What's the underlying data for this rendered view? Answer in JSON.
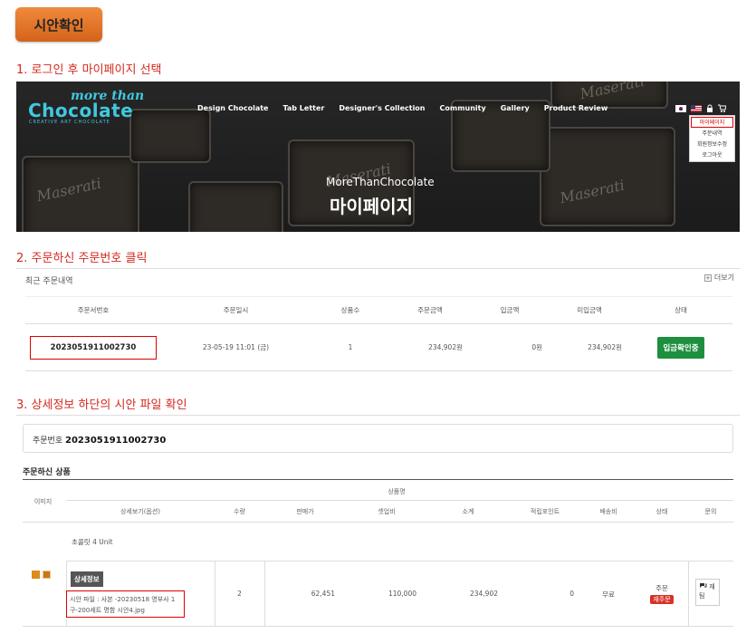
{
  "header": {
    "button_label": "시안확인"
  },
  "steps": {
    "step1": "1. 로그인 후 마이페이지 선택",
    "step2": "2. 주문하신 주문번호 클릭",
    "step3": "3. 상세정보 하단의 시안 파일 확인"
  },
  "hero": {
    "logo_line1": "more than",
    "logo_line2": "Chocolate",
    "logo_line3": "CREATIVE ART CHOCOLATE",
    "nav": [
      "Design Chocolate",
      "Tab Letter",
      "Designer's Collection",
      "Community",
      "Gallery",
      "Product Review"
    ],
    "dropdown": [
      "마이페이지",
      "주문내역",
      "회원정보수정",
      "로그아웃"
    ],
    "subtitle": "MoreThanChocolate",
    "title": "마이페이지",
    "choc_text": "Maserati"
  },
  "recent": {
    "title": "최근 주문내역",
    "more": "더보기",
    "columns": [
      "주문서번호",
      "주문일시",
      "상품수",
      "주문금액",
      "입금액",
      "미입금액",
      "상태"
    ],
    "row": {
      "order_no": "2023051911002730",
      "date": "23-05-19 11:01 (금)",
      "count": "1",
      "amount": "234,902원",
      "paid": "0원",
      "unpaid": "234,902원",
      "status": "입금확인중"
    }
  },
  "detail": {
    "order_label": "주문번호",
    "order_no": "2023051911002730",
    "section_title": "주문하신 상품",
    "col_image": "이미지",
    "col_product": "상품명",
    "columns": [
      "상세보기(옵션)",
      "수량",
      "판매가",
      "셋업비",
      "소계",
      "적립포인트",
      "배송비",
      "상태",
      "문의"
    ],
    "product_name": "초콜릿 4 Unit",
    "detail_tag": "상세정보",
    "file_text": "시안 파일 : 사본 -20230518 영부사 1구-200세트 명함 시안4.jpg",
    "qty": "2",
    "price": "62,451",
    "setup": "110,000",
    "subtotal": "234,902",
    "points": "0",
    "shipping": "무료",
    "status1": "주문",
    "status2": "재주문",
    "inquiry": "재팀"
  },
  "colors": {
    "accent_red": "#d4281e",
    "green": "#1e8f3e",
    "cyan": "#41c8e0",
    "orange": "#e07a2a"
  }
}
